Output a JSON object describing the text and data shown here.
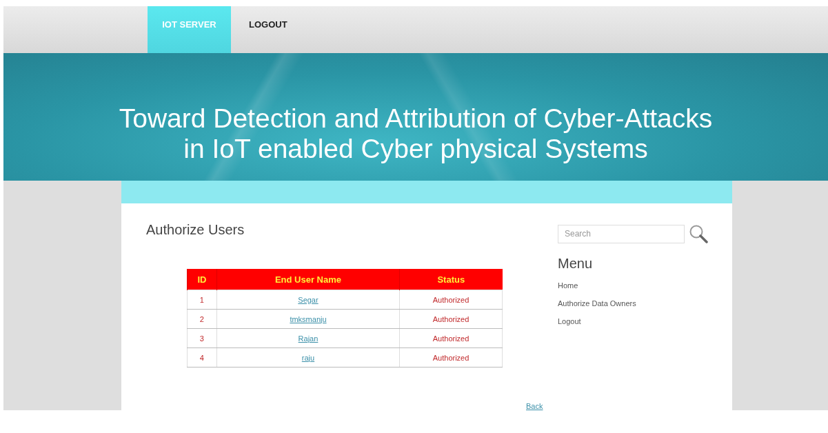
{
  "nav": {
    "tabs": [
      {
        "label": "IOT SERVER",
        "selected": true
      },
      {
        "label": "LOGOUT",
        "selected": false
      }
    ]
  },
  "banner": {
    "title": "Toward Detection and Attribution of Cyber-Attacks in IoT enabled Cyber physical Systems"
  },
  "main": {
    "heading": "Authorize Users",
    "table": {
      "columns": [
        "ID",
        "End User Name",
        "Status"
      ],
      "rows": [
        {
          "id": "1",
          "name": "Segar",
          "status": "Authorized"
        },
        {
          "id": "2",
          "name": "tmksmanju",
          "status": "Authorized"
        },
        {
          "id": "3",
          "name": "Rajan",
          "status": "Authorized"
        },
        {
          "id": "4",
          "name": "raju",
          "status": "Authorized"
        }
      ]
    },
    "back_link": "Back"
  },
  "sidebar": {
    "search": {
      "placeholder": "Search"
    },
    "menu_title": "Menu",
    "items": [
      "Home",
      "Authorize Data Owners",
      "Logout"
    ]
  }
}
